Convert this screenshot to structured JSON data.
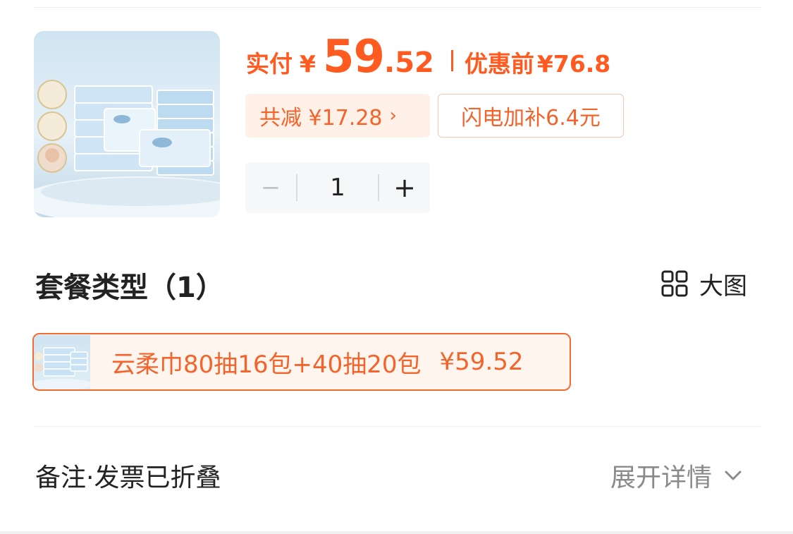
{
  "product": {
    "image_icon": "tissue-pack-product-image"
  },
  "price": {
    "paid_label": "实付",
    "currency": "¥",
    "integer": "59",
    "decimal": ".52",
    "original_label": "优惠前",
    "original_price": "¥76.8"
  },
  "discounts": {
    "reduce_text": "共减 ¥17.28",
    "reduce_arrow": "›",
    "flash_subsidy": "闪电加补6.4元"
  },
  "quantity": {
    "minus": "−",
    "value": "1",
    "plus": "+"
  },
  "package": {
    "title": "套餐类型（1）",
    "big_view_label": "大图",
    "options": [
      {
        "label": "云柔巾80抽16包+40抽20包",
        "price": "¥59.52",
        "selected": true
      }
    ]
  },
  "notes": {
    "label": "备注·发票已折叠",
    "expand_label": "展开详情"
  },
  "colors": {
    "accent": "#ff5a1f",
    "chip_bg": "#fff0e8",
    "stepper_bg": "#f5f7f9"
  }
}
